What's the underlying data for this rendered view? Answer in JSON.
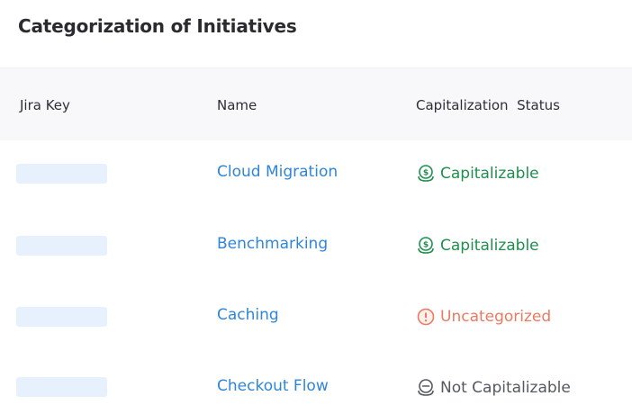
{
  "page": {
    "title": "Categorization of Initiatives"
  },
  "table": {
    "columns": {
      "jira_key": "Jira Key",
      "name": "Name",
      "status": "Capitalization  Status"
    },
    "rows": [
      {
        "jira_key": "",
        "name": "Cloud Migration",
        "status": "Capitalizable",
        "status_icon": "money-circle-icon",
        "status_color": "#1f8f4e"
      },
      {
        "jira_key": "",
        "name": "Benchmarking",
        "status": "Capitalizable",
        "status_icon": "money-circle-icon",
        "status_color": "#1f8f4e"
      },
      {
        "jira_key": "",
        "name": "Caching",
        "status": "Uncategorized",
        "status_icon": "alert-circle-icon",
        "status_color": "#ea7a62"
      },
      {
        "jira_key": "",
        "name": "Checkout Flow",
        "status": "Not Capitalizable",
        "status_icon": "minus-circle-icon",
        "status_color": "#55585f"
      }
    ]
  },
  "colors": {
    "link": "#2f86d8",
    "header_background": "#f8f8fb",
    "key_placeholder": "#e6f1fd"
  }
}
